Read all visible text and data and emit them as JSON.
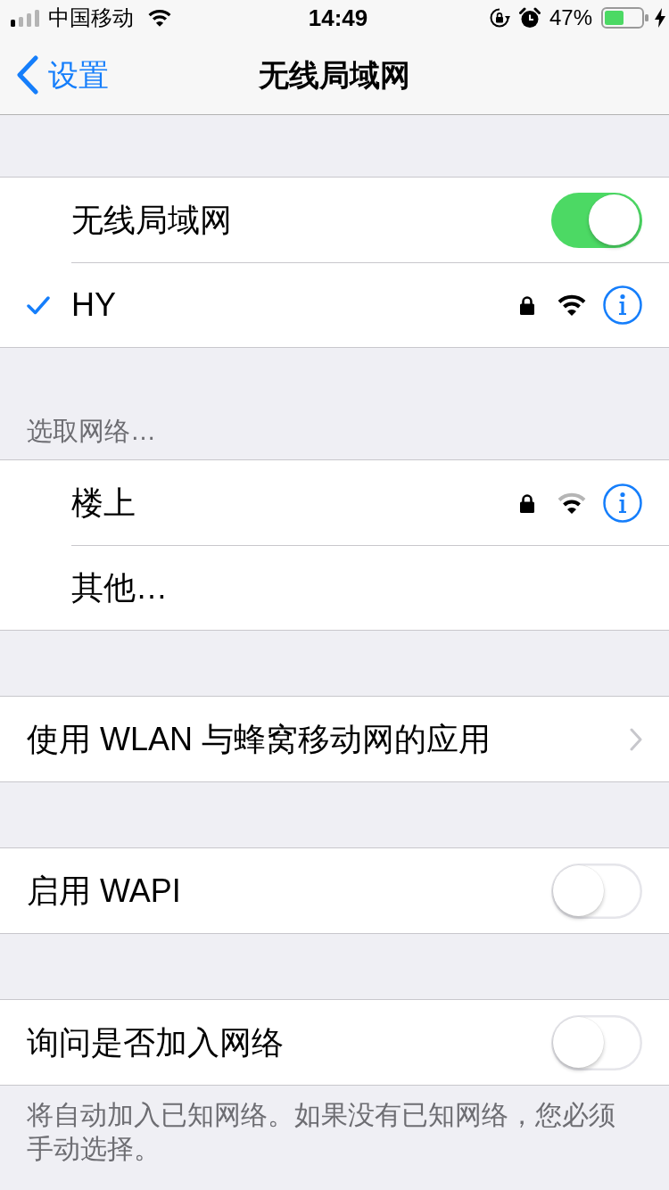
{
  "status_bar": {
    "carrier": "中国移动",
    "time": "14:49",
    "battery": "47%",
    "charging": true
  },
  "nav_bar": {
    "back": "设置",
    "title": "无线局域网"
  },
  "sections": [
    {
      "kind": "networks",
      "rows": [
        {
          "kind": "toggle",
          "label": "无线局域网",
          "on": true
        },
        {
          "kind": "network",
          "label": "HY",
          "selected": true,
          "locked": true,
          "weak_signal": false
        }
      ]
    },
    {
      "kind": "networks",
      "header": "选取网络…",
      "rows": [
        {
          "kind": "network",
          "label": "楼上",
          "selected": false,
          "locked": true,
          "weak_signal": true
        },
        {
          "kind": "link",
          "label": "其他…",
          "chevron": false
        }
      ]
    },
    {
      "kind": "plain",
      "rows": [
        {
          "kind": "link",
          "label": "使用 WLAN 与蜂窝移动网的应用",
          "chevron": true
        }
      ]
    },
    {
      "kind": "plain",
      "rows": [
        {
          "kind": "toggle",
          "label": "启用 WAPI",
          "on": false
        }
      ]
    },
    {
      "kind": "plain",
      "rows": [
        {
          "kind": "toggle",
          "label": "询问是否加入网络",
          "on": false
        }
      ]
    }
  ],
  "footer": "将自动加入已知网络。如果没有已知网络，您必须手动选择。"
}
